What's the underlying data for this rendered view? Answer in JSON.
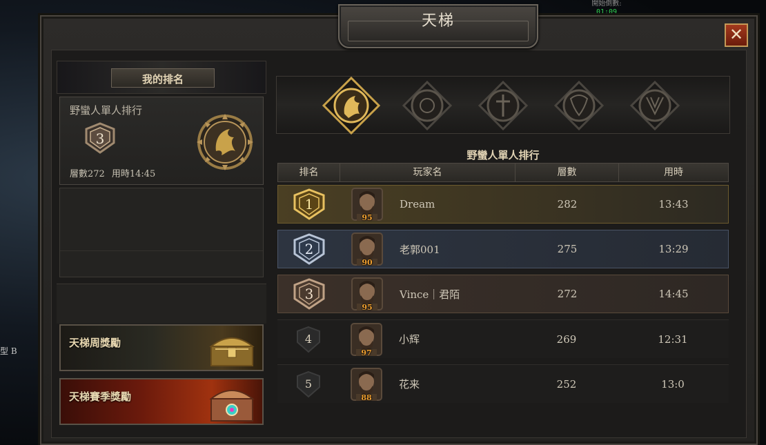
{
  "hud": {
    "label": "開始倒數:",
    "timer": "01:09"
  },
  "world_text": "型 B",
  "window": {
    "title": "天梯",
    "close": "✕"
  },
  "my_rank": {
    "header": "我的排名",
    "category": "野蠻人單人排行",
    "rank": "3",
    "floors": "層數272",
    "time": "用時14:45"
  },
  "rewards": {
    "weekly": "天梯周獎勵",
    "season": "天梯賽季獎勵"
  },
  "classes": [
    {
      "name": "barbarian-crest",
      "selected": true
    },
    {
      "name": "sorceress-crest",
      "selected": false
    },
    {
      "name": "necromancer-crest",
      "selected": false
    },
    {
      "name": "druid-crest",
      "selected": false
    },
    {
      "name": "rogue-crest",
      "selected": false
    }
  ],
  "table": {
    "title": "野蠻人單人排行",
    "headers": {
      "rank": "排名",
      "name": "玩家名",
      "floors": "層數",
      "time": "用時"
    },
    "rows": [
      {
        "rank": "1",
        "level": "95",
        "name": "Dream",
        "floors": "282",
        "time": "13:43"
      },
      {
        "rank": "2",
        "level": "90",
        "name": "老郭001",
        "floors": "275",
        "time": "13:29"
      },
      {
        "rank": "3",
        "level": "95",
        "name": "Vince｜君陌",
        "floors": "272",
        "time": "14:45"
      },
      {
        "rank": "4",
        "level": "97",
        "name": "小辉",
        "floors": "269",
        "time": "12:31"
      },
      {
        "rank": "5",
        "level": "88",
        "name": "花来",
        "floors": "252",
        "time": "13:0"
      }
    ]
  },
  "colors": {
    "gold": "#c9a24a",
    "silver": "#9aa6b8",
    "bronze": "#a07a5a",
    "accent": "#e2d4b5"
  }
}
